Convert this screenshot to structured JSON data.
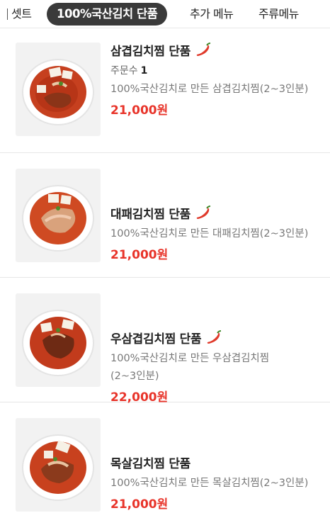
{
  "tabs": [
    {
      "label": "셋트",
      "active": false
    },
    {
      "label": "100%국산김치 단품",
      "active": true
    },
    {
      "label": "추가 메뉴",
      "active": false
    },
    {
      "label": "주류메뉴",
      "active": false
    }
  ],
  "items": [
    {
      "name": "삼겹김치찜 단품",
      "spicy_icon": "chili-pepper-icon",
      "orders_label": "주문수",
      "orders_count": "1",
      "description": "100%국산김치로 만든 삼겹김치찜(2~3인분)",
      "price": "21,000원"
    },
    {
      "name": "대패김치찜 단품",
      "spicy_icon": "chili-pepper-icon",
      "description": "100%국산김치로 만든 대패김치찜(2~3인분)",
      "price": "21,000원"
    },
    {
      "name": "우삼겹김치찜 단품",
      "spicy_icon": "chili-pepper-icon",
      "description": "100%국산김치로 만든 우삼겹김치찜(2~3인분)",
      "price": "22,000원"
    },
    {
      "name": "목살김치찜 단품",
      "description": "100%국산김치로 만든 목살김치찜(2~3인분)",
      "price": "21,000원"
    }
  ],
  "colors": {
    "price": "#e8342a",
    "active_tab_bg": "#3a3a3a",
    "chili": "#e03a2b"
  }
}
